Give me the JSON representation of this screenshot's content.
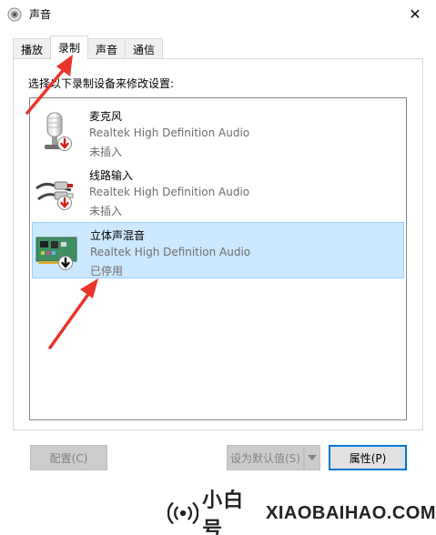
{
  "window": {
    "title": "声音",
    "close_glyph": "✕"
  },
  "tabs": [
    {
      "label": "播放",
      "active": false
    },
    {
      "label": "录制",
      "active": true
    },
    {
      "label": "声音",
      "active": false
    },
    {
      "label": "通信",
      "active": false
    }
  ],
  "instruction": "选择以下录制设备来修改设置:",
  "devices": [
    {
      "name": "麦克风",
      "description": "Realtek High Definition Audio",
      "status": "未插入",
      "icon": "microphone-icon",
      "badge": "red-down-arrow",
      "selected": false
    },
    {
      "name": "线路输入",
      "description": "Realtek High Definition Audio",
      "status": "未插入",
      "icon": "line-in-jack-icon",
      "badge": "red-down-arrow",
      "selected": false
    },
    {
      "name": "立体声混音",
      "description": "Realtek High Definition Audio",
      "status": "已停用",
      "icon": "sound-card-icon",
      "badge": "black-down-arrow",
      "selected": true
    }
  ],
  "buttons": {
    "configure": "配置(C)",
    "set_default": "设为默认值(S)",
    "properties": "属性(P)"
  },
  "watermark": {
    "chinese": "小白号",
    "english": "XIAOBAIHAO.COM"
  },
  "colors": {
    "selection": "#cce8ff",
    "selection_border": "#99d1ff",
    "annotation": "#e8342c",
    "default_button_border": "#0078d7"
  }
}
